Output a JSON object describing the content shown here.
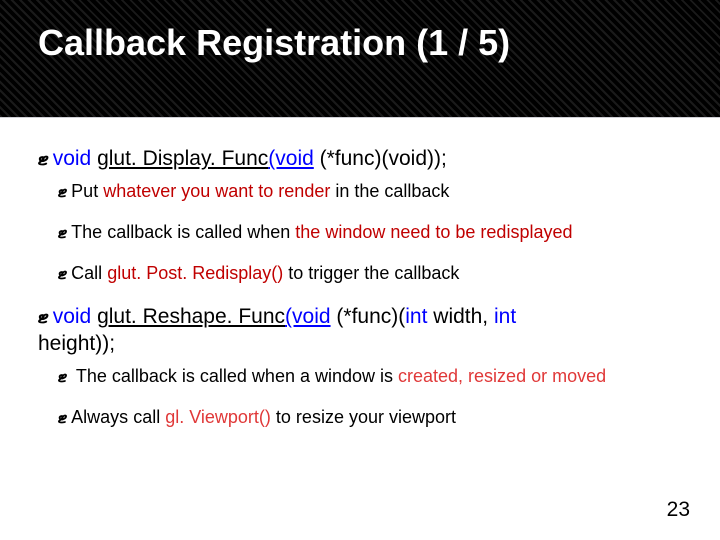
{
  "title": "Callback Registration (1 / 5)",
  "b1": "ޓ",
  "b2": "ޓ",
  "items": [
    {
      "kw1": "void",
      "fn": "glut. Display. Func",
      "sig_mid": "(void",
      "sig_tail": " (*func)(void));",
      "subs": [
        {
          "pre": "Put ",
          "em": "whatever you want to render",
          "post": " in the callback"
        },
        {
          "pre": "The callback is called when ",
          "em": "the window need to be redisplayed",
          "post": ""
        },
        {
          "pre": "Call ",
          "em": "glut. Post. Redisplay()",
          "post": " to trigger the callback"
        }
      ]
    },
    {
      "kw1": "void",
      "fn": "glut. Reshape. Func",
      "sig_mid": "(void",
      "sig_tail1": " (*func)(",
      "kw2": "int",
      "sig_tail2": " width, ",
      "kw3": "int",
      "sig_tail3": " height));",
      "subs": [
        {
          "pre": " The callback is called when a window is ",
          "em": "created, resized or moved",
          "post": ""
        },
        {
          "pre": "Always call ",
          "em": "gl. Viewport()",
          "post": " to resize your viewport"
        }
      ]
    }
  ],
  "page": "23"
}
